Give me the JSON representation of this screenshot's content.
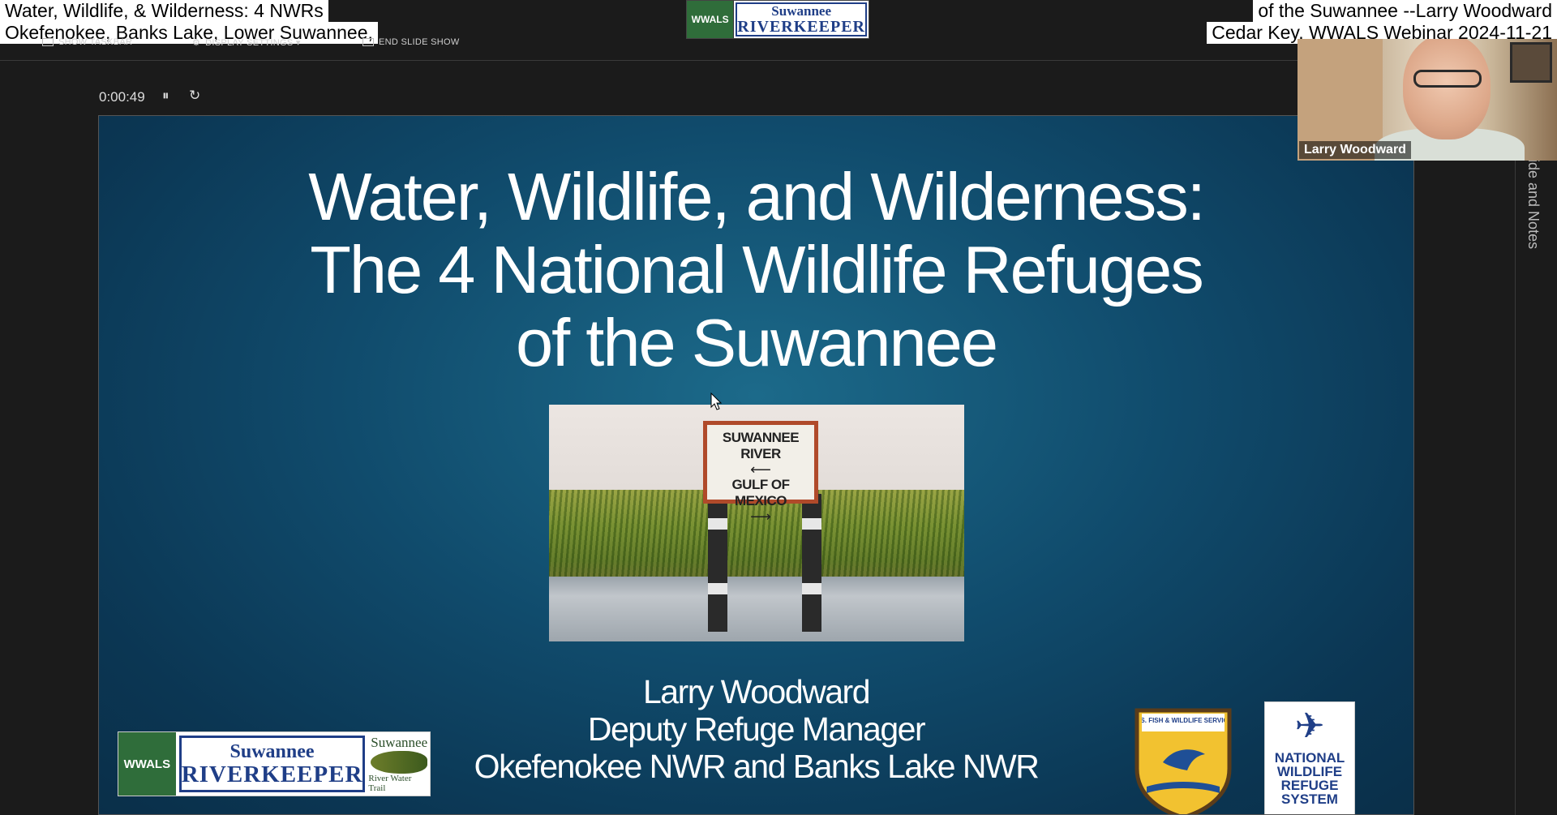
{
  "captions": {
    "left_line1": "Water, Wildlife, & Wilderness: 4 NWRs",
    "left_line2": "Okefenokee, Banks Lake, Lower Suwannee,",
    "right_line1": "of the Suwannee --Larry Woodward",
    "right_line2": "Cedar Key, WWALS Webinar 2024-11-21"
  },
  "center_logo": {
    "mini": "WWALS",
    "top": "Suwannee",
    "bottom": "RIVERKEEPER"
  },
  "toolbar": {
    "show_taskbar": "SHOW TASKBAR",
    "display_settings": "DISPLAY SETTINGS ▾",
    "end_slide_show": "END SLIDE SHOW"
  },
  "playback": {
    "timer": "0:00:49",
    "pause_icon": "⏸",
    "reset_icon": "↻"
  },
  "slide": {
    "title_lines": [
      "Water, Wildlife, and Wilderness:",
      "The 4 National Wildlife Refuges",
      "of the Suwannee"
    ],
    "photo_sign": {
      "line1": "SUWANNEE RIVER",
      "arrow_left": "⟵",
      "line2": "GULF OF MEXICO",
      "arrow_right": "⟶"
    },
    "presenter_lines": [
      "Larry Woodward",
      "Deputy Refuge Manager",
      "Okefenokee NWR and Banks Lake NWR"
    ],
    "logo_left": {
      "wwals": "WWALS",
      "rk_top": "Suwannee",
      "rk_bottom": "RIVERKEEPER",
      "trail_top": "Suwannee",
      "trail_bottom": "River Water Trail"
    },
    "fws_logo": {
      "top": "U.S. FISH & WILDLIFE SERVICE"
    },
    "nwrs_logo": {
      "line1": "NATIONAL",
      "line2": "WILDLIFE",
      "line3": "REFUGE",
      "line4": "SYSTEM"
    }
  },
  "side_panel": {
    "label": "ide and Notes"
  },
  "webcam": {
    "name": "Larry Woodward"
  }
}
